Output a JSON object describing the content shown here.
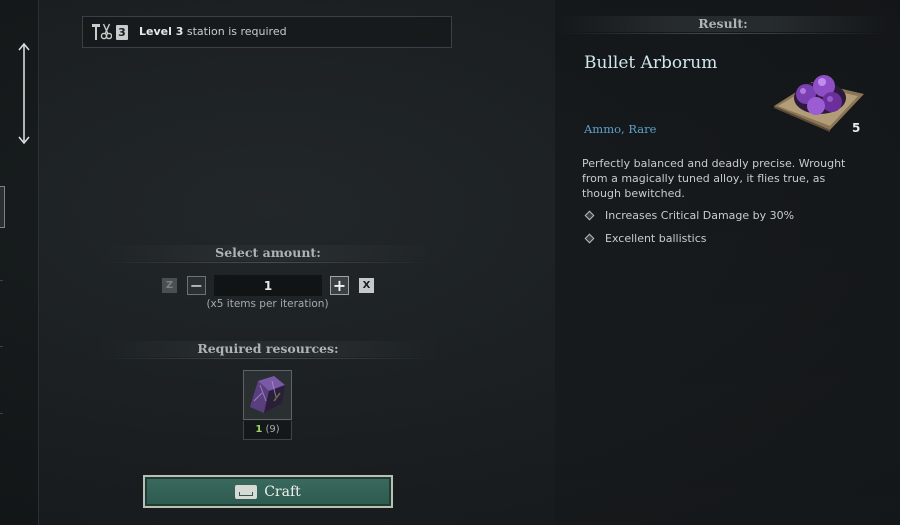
{
  "station": {
    "level_badge": "3",
    "level_label": "Level 3",
    "requirement_text": "station is required"
  },
  "amount": {
    "header": "Select amount:",
    "z_key": "Z",
    "minus": "−",
    "value": "1",
    "plus": "+",
    "x_key": "X",
    "note": "(x5 items per iteration)"
  },
  "resources": {
    "header": "Required resources:",
    "items": [
      {
        "icon": "purple-ore-ingot-icon",
        "have": "1",
        "total": "(9)"
      }
    ]
  },
  "craft": {
    "label": "Craft"
  },
  "result": {
    "header": "Result:",
    "name": "Bullet Arborum",
    "category": "Ammo, Rare",
    "quantity": "5",
    "icon": "bullet-arborum-icon",
    "description": "Perfectly balanced and deadly precise. Wrought from a magically tuned alloy, it flies true, as though bewitched.",
    "properties": [
      "Increases Critical Damage by 30%",
      "Excellent ballistics"
    ]
  },
  "colors": {
    "item_name": "#cfe6ee",
    "category": "#5fa0c8",
    "have_count": "#9ed36a",
    "craft_button": "#2e5a4f"
  }
}
